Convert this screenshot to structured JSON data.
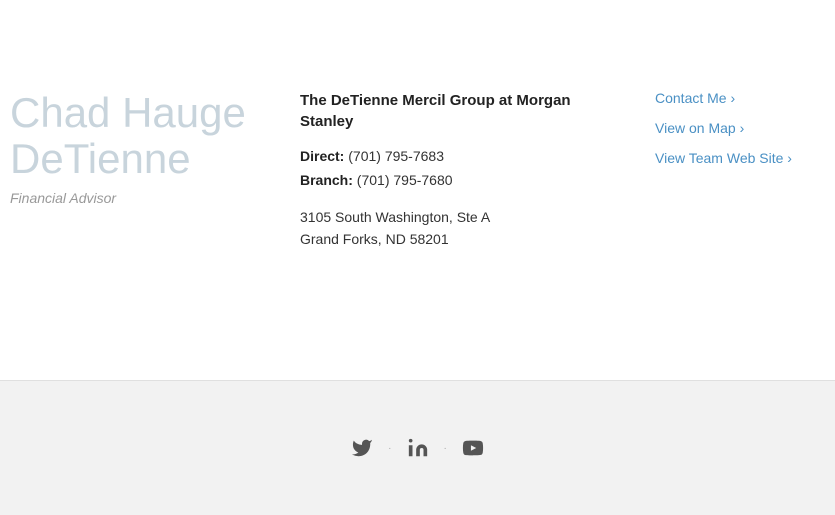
{
  "advisor": {
    "first_name": "Chad Hauge",
    "last_name": "DeTienne",
    "title": "Financial Advisor"
  },
  "firm": {
    "name_line1": "The DeTienne Mercil Group at Morgan",
    "name_line2": "Stanley"
  },
  "contact": {
    "direct_label": "Direct:",
    "direct_phone": "(701) 795-7683",
    "branch_label": "Branch:",
    "branch_phone": "(701) 795-7680",
    "address_line1": "3105 South Washington, Ste A",
    "address_line2": "Grand Forks, ND 58201"
  },
  "links": {
    "contact_me": "Contact Me ›",
    "view_on_map": "View on Map ›",
    "view_team_web_site": "View Team Web Site ›"
  },
  "social": {
    "separator": "·"
  }
}
